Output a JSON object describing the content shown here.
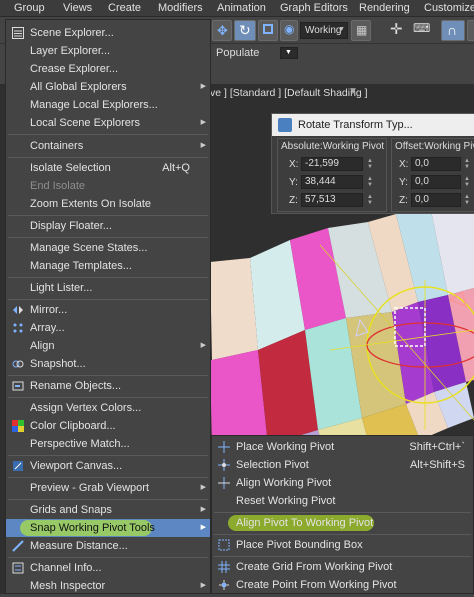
{
  "menubar": {
    "items": [
      "Group",
      "Views",
      "Create",
      "Modifiers",
      "Animation",
      "Graph Editors",
      "Rendering",
      "Customize"
    ]
  },
  "toolbar": {
    "coord_system": "Working",
    "populate": "Populate"
  },
  "viewport": {
    "label": "ve ] [Standard ] [Default Shading ]"
  },
  "rotate_dialog": {
    "title": "Rotate Transform Typ...",
    "absolute_title": "Absolute:Working Pivot",
    "offset_title": "Offset:Working Pivot",
    "abs": {
      "x": "-21,599",
      "y": "38,444",
      "z": "57,513"
    },
    "off": {
      "x": "0,0",
      "y": "0,0",
      "z": "0,0"
    },
    "x_label": "X:",
    "y_label": "Y:",
    "z_label": "Z:"
  },
  "left_menu": {
    "items": [
      {
        "label": "Scene Explorer...",
        "icon": "scene-explorer-icon"
      },
      {
        "label": "Layer Explorer..."
      },
      {
        "label": "Crease Explorer..."
      },
      {
        "label": "All Global Explorers",
        "arrow": true
      },
      {
        "label": "Manage Local Explorers..."
      },
      {
        "label": "Local Scene Explorers",
        "arrow": true
      },
      {
        "label": "Containers",
        "arrow": true
      },
      {
        "label": "Isolate Selection",
        "shortcut": "Alt+Q"
      },
      {
        "label": "End Isolate",
        "disabled": true
      },
      {
        "label": "Zoom Extents On Isolate"
      },
      {
        "label": "Display Floater..."
      },
      {
        "label": "Manage Scene States..."
      },
      {
        "label": "Manage Templates..."
      },
      {
        "label": "Light Lister..."
      },
      {
        "label": "Mirror...",
        "icon": "mirror-icon"
      },
      {
        "label": "Array...",
        "icon": "array-icon"
      },
      {
        "label": "Align",
        "arrow": true
      },
      {
        "label": "Snapshot...",
        "icon": "snapshot-icon"
      },
      {
        "label": "Rename Objects...",
        "icon": "rename-icon"
      },
      {
        "label": "Assign Vertex Colors..."
      },
      {
        "label": "Color Clipboard...",
        "icon": "color-clipboard-icon"
      },
      {
        "label": "Perspective Match..."
      },
      {
        "label": "Viewport Canvas...",
        "icon": "viewport-canvas-icon"
      },
      {
        "label": "Preview - Grab Viewport",
        "arrow": true
      },
      {
        "label": "Grids and Snaps",
        "arrow": true
      },
      {
        "label": "Snap Working Pivot Tools",
        "arrow": true,
        "highlighted": true
      },
      {
        "label": "Measure Distance...",
        "icon": "measure-icon"
      },
      {
        "label": "Channel Info...",
        "icon": "channel-info-icon"
      },
      {
        "label": "Mesh Inspector",
        "arrow": true
      }
    ]
  },
  "sub_menu": {
    "items": [
      {
        "label": "Place Working Pivot",
        "shortcut": "Shift+Ctrl+`"
      },
      {
        "label": "Selection Pivot",
        "shortcut": "Alt+Shift+S"
      },
      {
        "label": "Align Working Pivot"
      },
      {
        "label": "Reset Working Pivot"
      },
      {
        "label": "Align Pivot To Working Pivot"
      },
      {
        "label": "Place Pivot Bounding Box"
      },
      {
        "label": "Create Grid From Working Pivot"
      },
      {
        "label": "Create Point From Working Pivot"
      }
    ]
  },
  "colors": {
    "highlight": "#5d87c2",
    "annotation": "#c8ff1e"
  }
}
